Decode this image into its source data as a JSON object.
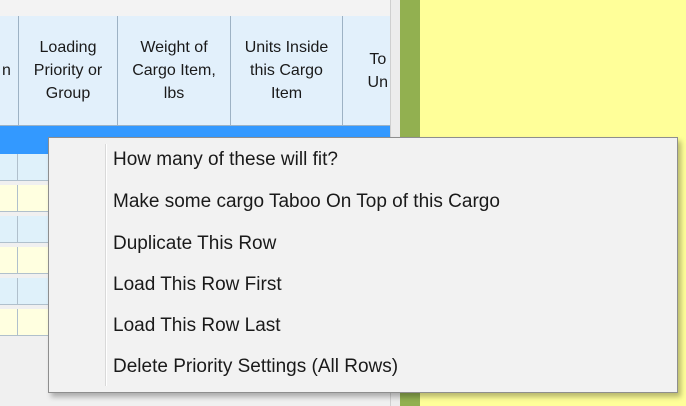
{
  "grid": {
    "columns": [
      {
        "label": "n"
      },
      {
        "label": "Loading\nPriority or\nGroup"
      },
      {
        "label": "Weight of\nCargo Item,\nlbs"
      },
      {
        "label": "Units Inside\nthis Cargo\nItem"
      },
      {
        "label": "To\nUn"
      }
    ],
    "row_colors": [
      "#dff1fa",
      "#ffffe0",
      "#dff1fa",
      "#ffffe0",
      "#dff1fa",
      "#ffffe0"
    ],
    "selected_row_color": "#3399ff",
    "panel_color": "#ffff99",
    "divider_color": "#92b050"
  },
  "context_menu": {
    "items": [
      {
        "label": "How many of these will fit?"
      },
      {
        "label": "Make some cargo Taboo On Top of this Cargo"
      },
      {
        "label": "Duplicate This Row"
      },
      {
        "label": "Load This Row First"
      },
      {
        "label": "Load This Row Last"
      },
      {
        "label": "Delete Priority Settings (All Rows)"
      }
    ]
  }
}
